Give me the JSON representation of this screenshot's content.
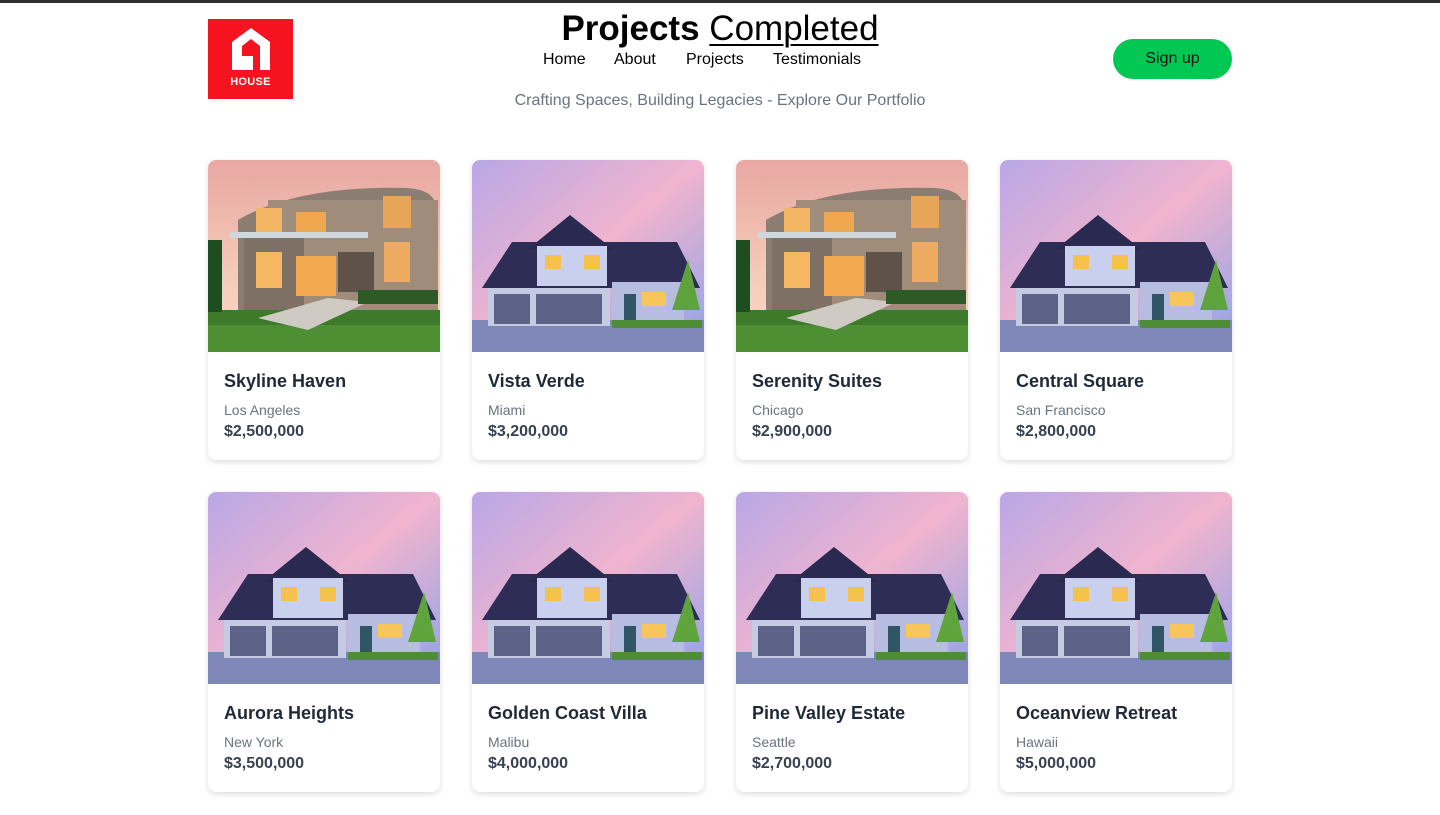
{
  "brand": {
    "logo_text": "HOUSE",
    "logo_color": "#f5131f"
  },
  "header": {
    "title_bold": "Projects",
    "title_underlined": "Completed",
    "subtitle": "Crafting Spaces, Building Legacies - Explore Our Portfolio"
  },
  "nav": {
    "items": [
      "Home",
      "About",
      "Projects",
      "Testimonials"
    ]
  },
  "signup": {
    "label": "Sign up",
    "color": "#00c853"
  },
  "projects": [
    {
      "name": "Skyline Haven",
      "city": "Los Angeles",
      "price": "$2,500,000",
      "image": "modern-villa-photo"
    },
    {
      "name": "Vista Verde",
      "city": "Miami",
      "price": "$3,200,000",
      "image": "suburban-house-photo"
    },
    {
      "name": "Serenity Suites",
      "city": "Chicago",
      "price": "$2,900,000",
      "image": "modern-villa-photo"
    },
    {
      "name": "Central Square",
      "city": "San Francisco",
      "price": "$2,800,000",
      "image": "suburban-house-photo"
    },
    {
      "name": "Aurora Heights",
      "city": "New York",
      "price": "$3,500,000",
      "image": "suburban-house-photo"
    },
    {
      "name": "Golden Coast Villa",
      "city": "Malibu",
      "price": "$4,000,000",
      "image": "suburban-house-photo"
    },
    {
      "name": "Pine Valley Estate",
      "city": "Seattle",
      "price": "$2,700,000",
      "image": "suburban-house-photo"
    },
    {
      "name": "Oceanview Retreat",
      "city": "Hawaii",
      "price": "$5,000,000",
      "image": "suburban-house-photo"
    }
  ]
}
